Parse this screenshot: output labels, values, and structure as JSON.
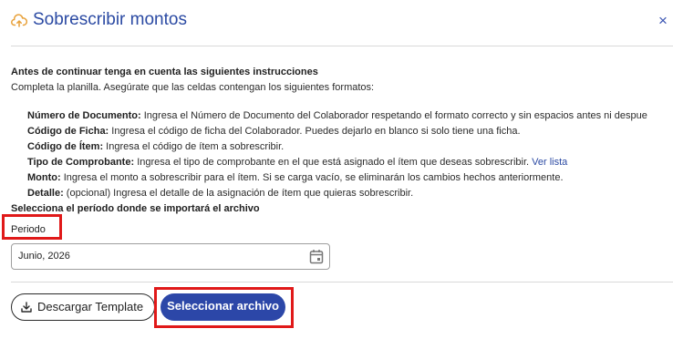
{
  "dialog": {
    "title": "Sobrescribir montos",
    "title_icon": "cloud-upload-icon",
    "close_icon": "close-icon",
    "close_glyph": "×"
  },
  "instructions": {
    "heading": "Antes de continuar tenga en cuenta las siguientes instrucciones",
    "subheading": "Completa la planilla. Asegúrate que las celdas contengan los siguientes formatos:",
    "items": [
      {
        "term": "Número de Documento:",
        "desc": " Ingresa el Número de Documento del Colaborador respetando el formato correcto y sin espacios antes ni despue"
      },
      {
        "term": "Código de Ficha:",
        "desc": " Ingresa el código de ficha del Colaborador. Puedes dejarlo en blanco si solo tiene una ficha."
      },
      {
        "term": "Código de Ítem:",
        "desc": " Ingresa el código de ítem a sobrescribir."
      },
      {
        "term": "Tipo de Comprobante:",
        "desc": " Ingresa el tipo de comprobante en el que está asignado el ítem que deseas sobrescribir. ",
        "link": "Ver lista"
      },
      {
        "term": "Monto:",
        "desc": " Ingresa el monto a sobrescribir para el ítem. Si se carga vacío, se eliminarán los cambios hechos anteriormente."
      },
      {
        "term": "Detalle:",
        "desc": " (opcional) Ingresa el detalle de la asignación de ítem que quieras sobrescribir."
      }
    ]
  },
  "period": {
    "heading": "Selecciona el período donde se importará el archivo",
    "label": "Periodo",
    "value": "Junio, 2026",
    "calendar_icon": "calendar-icon"
  },
  "actions": {
    "download_label": "Descargar Template",
    "download_icon": "download-icon",
    "select_label": "Seleccionar archivo"
  },
  "colors": {
    "accent": "#2c47a8",
    "highlight": "#e01919"
  }
}
